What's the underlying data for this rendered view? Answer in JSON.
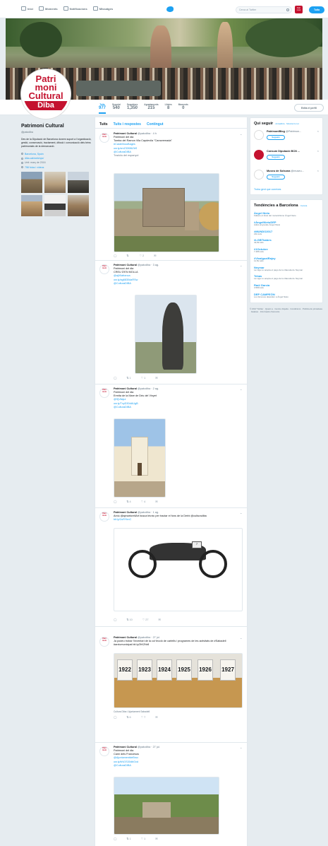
{
  "topbar": {
    "nav": [
      "Inici",
      "Moments",
      "Notificacions",
      "Missatges"
    ],
    "search_placeholder": "Cerca al Twitter",
    "tweet_label": "Tuita",
    "avatar_text": "Patri moni"
  },
  "logo": {
    "l1": "Patri",
    "l2": "moni",
    "l3": "Cultural",
    "l4": "Diba"
  },
  "stats": [
    {
      "label": "Tuits",
      "value": "977"
    },
    {
      "label": "Seguint",
      "value": "540"
    },
    {
      "label": "Seguidors",
      "value": "1,350"
    },
    {
      "label": "Agradaments",
      "value": "215"
    },
    {
      "label": "Llistes",
      "value": "8"
    },
    {
      "label": "Moments",
      "value": "0"
    }
  ],
  "edit_profile": "Edita el perfil",
  "profile": {
    "name": "Patrimoni Cultural",
    "handle": "@patcdiba",
    "bio": "Des de la Diputació de Barcelona donem suport a l'organització, gestió, conservació, tractament, difusió i comunicació dels béns patrimonials de la demarcació.",
    "location": "Barcelona, Spain",
    "url": "diba.cat/web/opc/",
    "joined": "Unit: març de 2016",
    "media": "758 fotos i vídeos"
  },
  "tabs": [
    "Tuits",
    "Tuits i respostes",
    "Contingut"
  ],
  "tweets": [
    {
      "name": "Patrimoni Cultural",
      "meta": "@patcdiba · 4 h",
      "lines": [
        "Patrimoni del dia",
        "Tomba del Ramon Vila Capdevila \"Caracremada\"",
        "#CastellnouBages",
        "ow.ly/zmZ3308tZbS",
        "@CulturaDIBA"
      ],
      "extra": "Traduïu del espanyol",
      "actions": [
        "",
        "",
        "2",
        ""
      ]
    },
    {
      "name": "Patrimoni Cultural",
      "meta": "@patcdiba · 3 ag.",
      "lines": [
        "Patrimoni del dia",
        "CREU D'EN MOLLA",
        "@ajVilafranca",
        "ow.ly/ag6830daRSw",
        "@CulturaDIBA"
      ],
      "extra": "",
      "actions": [
        "",
        "1",
        "1",
        ""
      ]
    },
    {
      "name": "Patrimoni Cultural",
      "meta": "@patcdiba · 2 ag.",
      "lines": [
        "Patrimoni del dia",
        "Ermita de la Mare de Déu del Vinyet",
        "@SjVilajui",
        "ow.ly/TxyD30dAUgB",
        "@CulturaDIBA"
      ],
      "extra": "",
      "actions": [
        "",
        "4",
        "4",
        ""
      ]
    },
    {
      "name": "Patrimoni Cultural",
      "meta": "@patcdiba · 1 ag.",
      "lines": [
        "Arxiu @ajmartorellArt busca tècnic per tractar el fons de la Derbi @culturadiba",
        "bit.ly/2uRYbnC"
      ],
      "extra": "",
      "actions": [
        "",
        "10",
        "27",
        ""
      ]
    },
    {
      "name": "Patrimoni Cultural",
      "meta": "@patcdiba · 27 jul.",
      "lines": [
        "Ja podeu trobar l'inventari de la col·lecció de cartells i programes de les activitats de #Sabadell #arxiumunicipal bit.ly/2tK2Nr8"
      ],
      "extra": "Cultura Diba i Ajuntament Sabadell",
      "actions": [
        "",
        "6",
        "7",
        ""
      ]
    },
    {
      "name": "Patrimoni Cultural",
      "meta": "@patcdiba · 27 jul.",
      "lines": [
        "Patrimoni del dia",
        "Camí dels Francesos",
        "@AjuntamentdeBruc",
        "ow.ly/kNGS30dbGxd",
        "@CulturaDIBA"
      ],
      "extra": "",
      "actions": [
        "",
        "1",
        "1",
        ""
      ]
    }
  ],
  "wtf": {
    "title": "Qui seguir",
    "sub": "· Actualitza · Mostra-ho tot",
    "items": [
      {
        "name": "PatrimoniBlog",
        "handle": "@Patrimon...",
        "follow": "Segueix"
      },
      {
        "name": "Consum Diputació BCN ...",
        "handle": "",
        "follow": "Segueix"
      },
      {
        "name": "Museu de Solsona",
        "handle": "@museu...",
        "follow": "Segueix"
      }
    ],
    "find": "Troba gent que coneixes"
  },
  "trends": {
    "title": "Tendències a Barcelona",
    "sub": "· Canvia",
    "items": [
      {
        "name": "Àngel Nieto",
        "desc": "Fallece el ídolo del motociclismo Ángel Nieto"
      },
      {
        "name": "#ÀngelNietoDEP",
        "desc": "Adiós al grande Àngel Nieto"
      },
      {
        "name": "#MUNDO2017",
        "desc": "21k tuits"
      },
      {
        "name": "#LGBTbabes",
        "desc": "42,8k tuits"
      },
      {
        "name": "#1Octubre",
        "desc": "7.486 tuits"
      },
      {
        "name": "#VivaIgualRajoy",
        "desc": "11,5k tuits"
      },
      {
        "name": "Neymar",
        "desc": "La Liga no acepta el pago de la cláusula de Neymar"
      },
      {
        "name": "Tebas",
        "desc": "La Liga no acepta el pago de la cláusula de Neymar"
      },
      {
        "name": "Raúl García",
        "desc": "3.589 tuits"
      },
      {
        "name": "DEP CAMPEÓN",
        "desc": "Los famosos despiden a Ángel Nieto"
      }
    ]
  },
  "footer": "© 2017 Twitter · Quant a · Centre d'ajuda · Condicions · Política de privadesa · Galetes · Informació d'anuncis",
  "images": {
    "box_numbers": [
      "1922",
      "1923",
      "1924",
      "1925",
      "1926",
      "1927"
    ],
    "plate": "7"
  }
}
